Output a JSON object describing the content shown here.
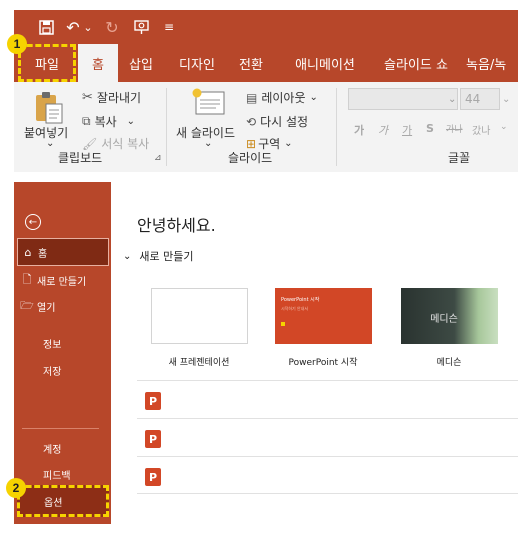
{
  "ribbon": {
    "qat": {
      "save_icon": "💾",
      "undo_icon": "↶",
      "dropdown": "⌄",
      "redo_icon": "↻",
      "present_icon": "⊡",
      "customize": "≡"
    },
    "tabs": [
      "파일",
      "홈",
      "삽입",
      "디자인",
      "전환",
      "애니메이션",
      "슬라이드 쇼",
      "녹음/녹"
    ],
    "active_tab": "홈",
    "clipboard": {
      "paste": "붙여넣기",
      "cut": "잘라내기",
      "copy": "복사",
      "copy_dropdown": "⌄",
      "format_painter": "서식 복사",
      "group_label": "클립보드"
    },
    "slides": {
      "new_slide": "새 슬라이드",
      "layout": "레이아웃",
      "reset": "다시 설정",
      "section": "구역",
      "group_label": "슬라이드"
    },
    "font": {
      "font_size": "44",
      "styles": [
        "가",
        "가",
        "가",
        "S",
        "가나",
        "갔나"
      ],
      "group_label": "글꼴"
    }
  },
  "backstage": {
    "back_icon": "←",
    "nav": {
      "home": "홈",
      "new": "새로 만들기",
      "open": "열기",
      "info": "정보",
      "save": "저장",
      "account": "계정",
      "feedback": "피드백",
      "options": "옵션"
    },
    "greeting": "안녕하세요.",
    "new_section": "새로 만들기",
    "templates": [
      {
        "label": "새 프레젠테이션"
      },
      {
        "label": "PowerPoint 시작",
        "thumb_title": "PowerPoint 시작",
        "thumb_sub": "시작하기 안내서"
      },
      {
        "label": "메디슨",
        "thumb_title": "메디슨"
      }
    ],
    "recent_count": 3
  },
  "annotations": {
    "badge1": "1",
    "badge2": "2"
  },
  "colors": {
    "accent": "#b7472a",
    "active_nav": "#7f2a14",
    "highlight": "#f6d300"
  }
}
